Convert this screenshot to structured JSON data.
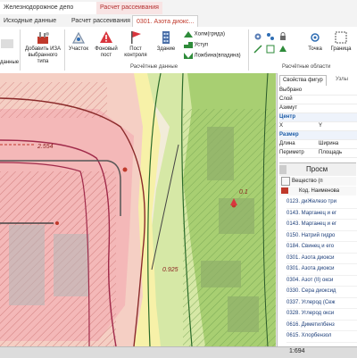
{
  "tabs": {
    "doc1": "Железнодорожное депо",
    "doc2": "Расчет рассеивания",
    "ribbon1": "Исходные данные",
    "ribbon2": "Расчет рассеивания",
    "ribbon3": "0301. Азота диокс..."
  },
  "ribbon": {
    "left_label": "данные",
    "izav_label": "Добавить ИЗА выбранного типа",
    "uchastok": "Участок",
    "fon_post": "Фоновый пост",
    "post_kontrolya": "Пост контроля",
    "zdanie": "Здание",
    "holm": "Холм(гряда)",
    "ustup": "Уступ",
    "lozhbina": "Ложбина(впадина)",
    "group_rasch": "Расчётные данные",
    "tochka": "Точка",
    "granica": "Граница",
    "group_oblasti": "Расчётные области"
  },
  "map": {
    "label1": "2.554",
    "label2": "0.925",
    "label3": "0.1"
  },
  "panel": {
    "tab1": "Свойства фигур",
    "tab2": "Узлы",
    "props": [
      {
        "k": "Выбрано",
        "v": "",
        "head": false
      },
      {
        "k": "Слой",
        "v": "",
        "head": false
      },
      {
        "k": "Азимут",
        "v": "",
        "head": false
      },
      {
        "k": "Центр",
        "v": "",
        "head": true
      },
      {
        "k": "X",
        "v": "Y",
        "head": false
      },
      {
        "k": "Размер",
        "v": "",
        "head": true
      },
      {
        "k": "Длина",
        "v": "Ширина",
        "head": false
      },
      {
        "k": "Периметр",
        "v": "Площадь",
        "head": false
      }
    ],
    "list_title": "Просм",
    "col_substance": "Вещество (п",
    "col_code": "Код. Наименова",
    "substances": [
      "0123. диЖелезо три",
      "0143. Марганец и ег",
      "0143. Марганец и ег",
      "0150. Натрий гидро",
      "0184. Свинец и его",
      "0301. Азота диокси",
      "0301. Азота диокси",
      "0304. Азот (II) окси",
      "0330. Сера диоксид",
      "0337. Углерод (Сеж",
      "0328. Углерод окси",
      "0616. Диметилбенз",
      "0615. Хлорбензол"
    ]
  },
  "status": {
    "coords": "1:694"
  }
}
